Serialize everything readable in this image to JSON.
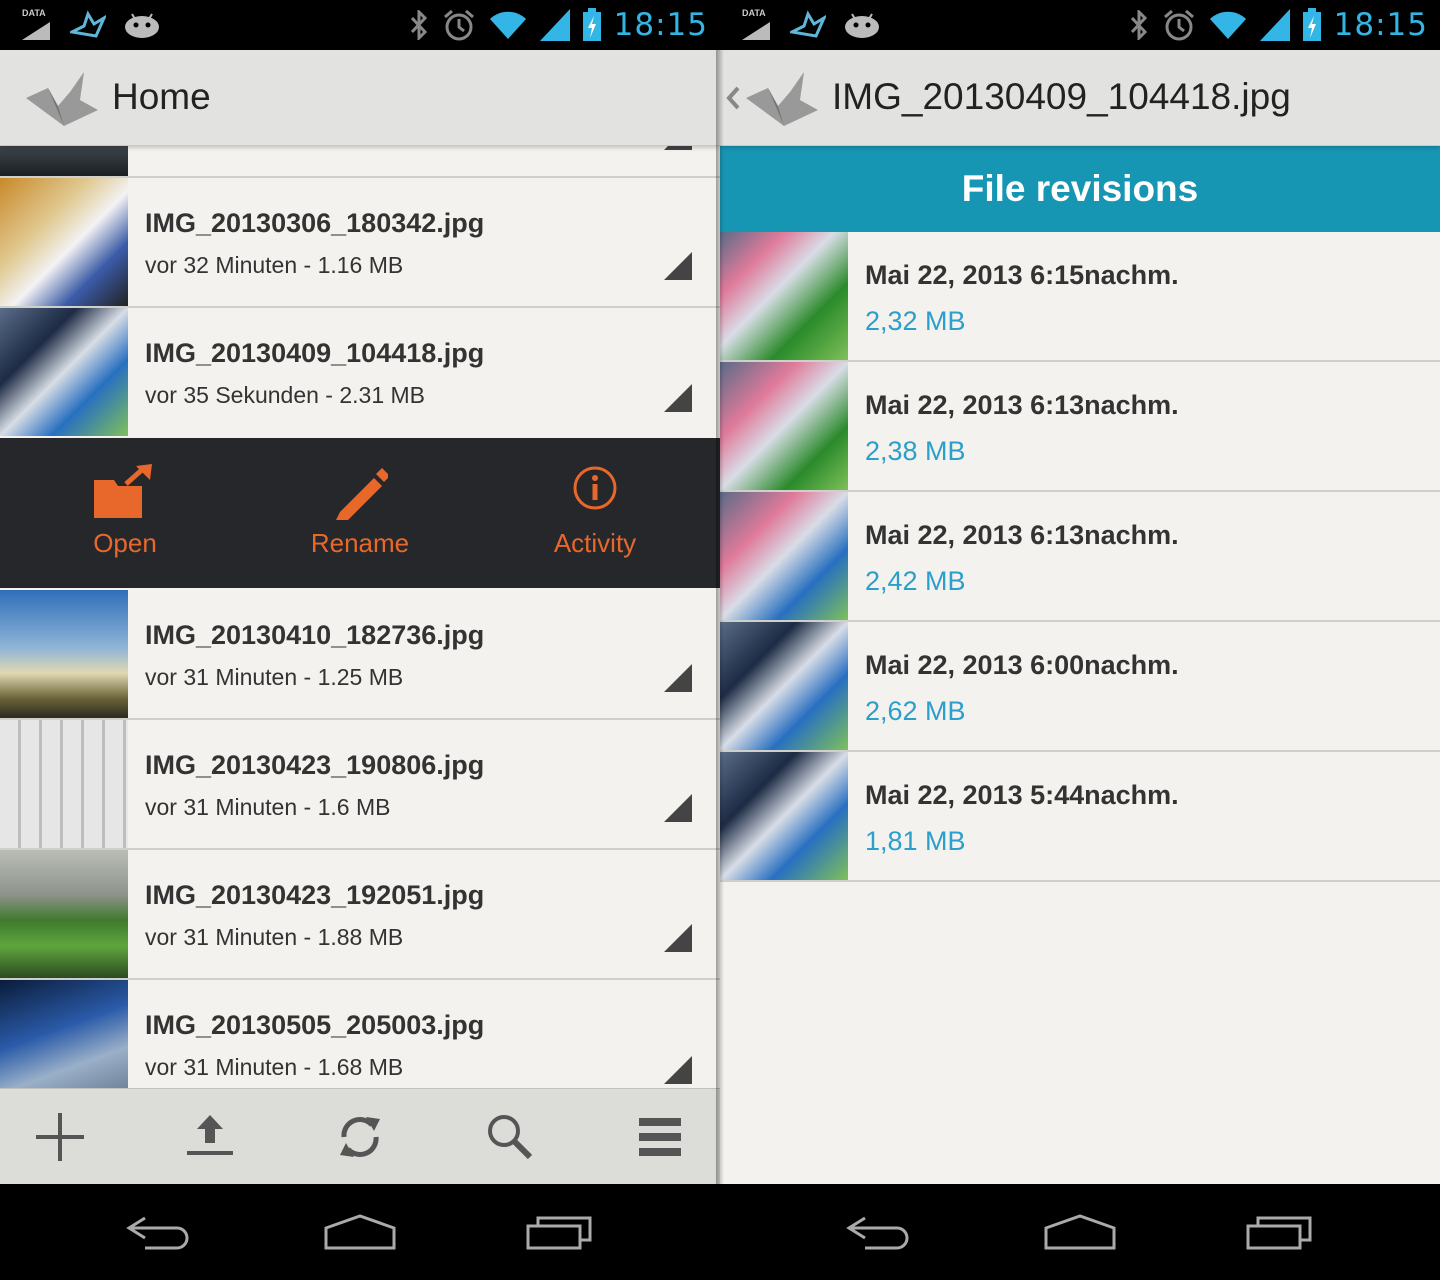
{
  "status_bar": {
    "time": "18:15",
    "data_label": "DATA",
    "icons": [
      "data-sim-icon",
      "cloud-app-icon",
      "android-debug-icon",
      "bluetooth-icon",
      "alarm-icon",
      "wifi-icon",
      "signal-icon",
      "battery-charging-icon"
    ]
  },
  "left_panel": {
    "action_bar": {
      "title": "Home",
      "logo": "crane-logo-icon"
    },
    "files": [
      {
        "name": "IMG_20130306_180342.jpg",
        "meta": "vor 32 Minuten  -  1.16 MB"
      },
      {
        "name": "IMG_20130409_104418.jpg",
        "meta": "vor 35 Sekunden  -  2.31 MB"
      },
      {
        "name": "IMG_20130410_182736.jpg",
        "meta": "vor 31 Minuten  -  1.25 MB"
      },
      {
        "name": "IMG_20130423_190806.jpg",
        "meta": "vor 31 Minuten  -  1.6 MB"
      },
      {
        "name": "IMG_20130423_192051.jpg",
        "meta": "vor 31 Minuten  -  1.88 MB"
      },
      {
        "name": "IMG_20130505_205003.jpg",
        "meta": "vor 31 Minuten  -  1.68 MB"
      }
    ],
    "quick_actions": [
      {
        "label": "Open",
        "icon": "folder-open-icon"
      },
      {
        "label": "Rename",
        "icon": "pencil-icon"
      },
      {
        "label": "Activity",
        "icon": "info-icon"
      }
    ],
    "toolbar": [
      "add-icon",
      "upload-icon",
      "refresh-icon",
      "search-icon",
      "menu-icon"
    ]
  },
  "right_panel": {
    "action_bar": {
      "title": "IMG_20130409_104418.jpg",
      "logo": "crane-logo-icon"
    },
    "header": "File revisions",
    "revisions": [
      {
        "date": "Mai 22, 2013 6:15nachm.",
        "size": "2,32 MB"
      },
      {
        "date": "Mai 22, 2013 6:13nachm.",
        "size": "2,38 MB"
      },
      {
        "date": "Mai 22, 2013 6:13nachm.",
        "size": "2,42 MB"
      },
      {
        "date": "Mai 22, 2013 6:00nachm.",
        "size": "2,62 MB"
      },
      {
        "date": "Mai 22, 2013 5:44nachm.",
        "size": "1,81 MB"
      }
    ]
  },
  "nav_bar": [
    "back-icon",
    "home-icon",
    "recent-apps-icon"
  ],
  "colors": {
    "accent_orange": "#e8682b",
    "revision_blue": "#1796b4",
    "size_blue": "#2a9fcb",
    "status_blue": "#33b5e5"
  }
}
